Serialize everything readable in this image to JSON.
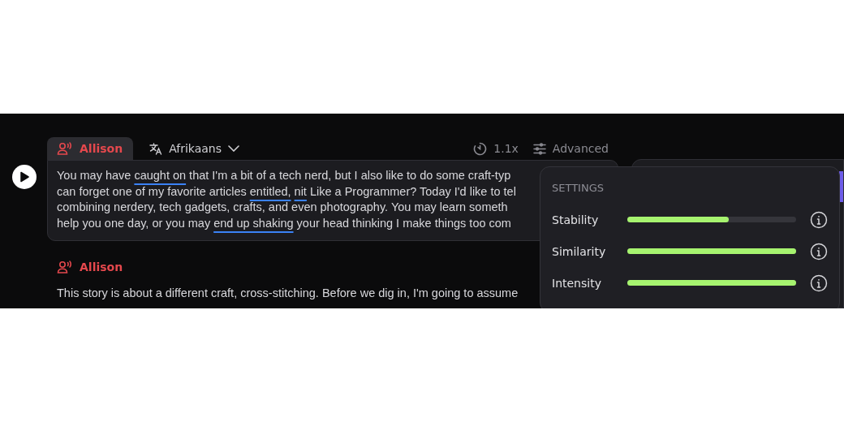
{
  "blocks": [
    {
      "speaker": "Allison",
      "selected": true,
      "language": "Afrikaans",
      "speed": "1.1x",
      "advanced": "Advanced",
      "lines": [
        {
          "segments": [
            {
              "text": "You may have ",
              "underline": false
            },
            {
              "text": "caught on",
              "underline": true
            },
            {
              "text": " that I'm a bit of a tech nerd, but I also like to do some craft-typ",
              "underline": false
            }
          ]
        },
        {
          "segments": [
            {
              "text": "can forget one of my favorite articles ",
              "underline": false
            },
            {
              "text": "entitled,",
              "underline": true
            },
            {
              "text": " nit",
              "underline": true
            },
            {
              "text": " Like a Programmer? Today I'd like to tel",
              "underline": false
            }
          ]
        },
        {
          "segments": [
            {
              "text": "combining nerdery, tech gadgets, crafts, and even photography. You may learn someth",
              "underline": false
            }
          ]
        },
        {
          "segments": [
            {
              "text": "help you one day, or you may ",
              "underline": false
            },
            {
              "text": "end up shaking",
              "underline": true
            },
            {
              "text": " your head thinking I make things too com",
              "underline": false
            }
          ]
        }
      ]
    },
    {
      "speaker": "Allison",
      "selected": false,
      "lines": [
        {
          "segments": [
            {
              "text": "This story is about a different craft, cross-stitching. Before we dig in, I'm going to assume",
              "underline": false
            }
          ]
        }
      ]
    }
  ],
  "settings": {
    "title": "SETTINGS",
    "sliders": [
      {
        "label": "Stability",
        "level": 0.6
      },
      {
        "label": "Similarity",
        "level": 1
      },
      {
        "label": "Intensity",
        "level": 1
      }
    ]
  }
}
